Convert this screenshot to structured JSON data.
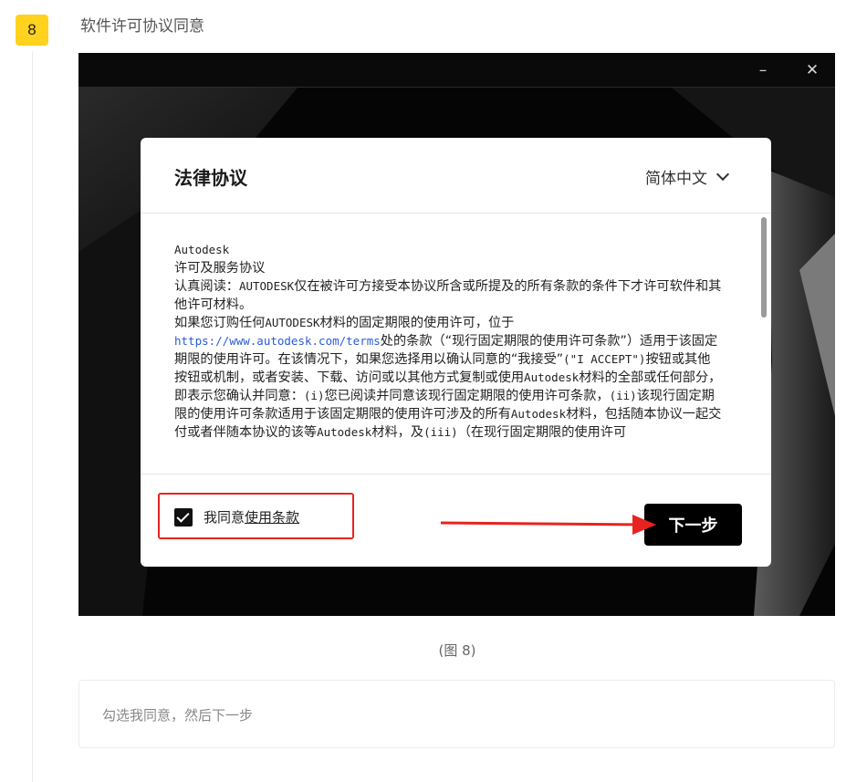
{
  "step": {
    "number": "8",
    "title": "软件许可协议同意"
  },
  "window": {
    "minimize": "–",
    "close": "✕"
  },
  "dialog": {
    "title": "法律协议",
    "language": "简体中文",
    "agreement": {
      "company": "Autodesk",
      "heading": "许可及服务协议",
      "p1_a": "认真阅读：",
      "p1_mono": "AUTODESK",
      "p1_b": "仅在被许可方接受本协议所含或所提及的所有条款的条件下才许可软件和其他许可材料。",
      "p2_a": "如果您订购任何",
      "p2_mono": "AUTODESK",
      "p2_b": "材料的固定期限的使用许可，位于",
      "p2_link": "https://www.autodesk.com/terms",
      "p2_c": "处的条款（“现行固定期限的使用许可条款”）适用于该固定期限的使用许可。在该情况下，如果您选择用以确认同意的“我接受”",
      "p2_mono2": "(\"I ACCEPT\")",
      "p2_d": "按钮或其他按钮或机制，或者安装、下载、访问或以其他方式复制或使用",
      "p2_mono3": "Autodesk",
      "p2_e": "材料的全部或任何部分，即表示您确认并同意：",
      "p2_mono4": "(i)",
      "p2_f": "您已阅读并同意该现行固定期限的使用许可条款，",
      "p2_mono5": "(ii)",
      "p2_g": "该现行固定期限的使用许可条款适用于该固定期限的使用许可涉及的所有",
      "p2_mono6": "Autodesk",
      "p2_h": "材料，包括随本协议一起交付或者伴随本协议的该等",
      "p2_mono7": "Autodesk",
      "p2_i": "材料，及",
      "p2_mono8": "(iii)",
      "p2_j": "（在现行固定期限的使用许可"
    },
    "agree_prefix": "我同意",
    "agree_link": "使用条款",
    "next_button": "下一步"
  },
  "caption": "(图 8)",
  "note": "勾选我同意，然后下一步",
  "colors": {
    "badge": "#ffd21e",
    "highlight": "#e8231f",
    "link": "#2a5bd7"
  }
}
